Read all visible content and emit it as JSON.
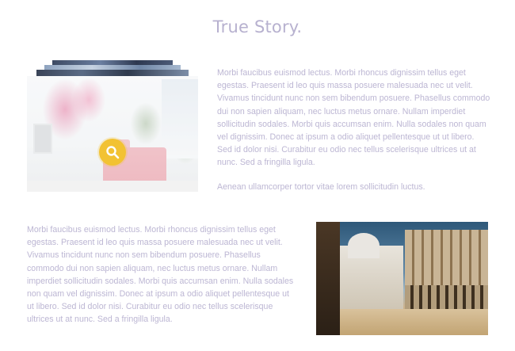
{
  "page": {
    "title": "True Story."
  },
  "gallery": {
    "search_icon": "search-icon",
    "accent_color": "#f2c233"
  },
  "sections": [
    {
      "paragraph": "Morbi faucibus euismod lectus. Morbi rhoncus dignissim tellus eget egestas. Praesent id leo quis massa posuere malesuada nec ut velit. Vivamus tincidunt nunc non sem bibendum posuere. Phasellus commodo dui non sapien aliquam, nec luctus metus ornare. Nullam imperdiet sollicitudin sodales. Morbi quis accumsan enim. Nulla sodales non quam vel dignissim. Donec at ipsum a odio aliquet pellentesque ut ut libero. Sed id dolor nisi. Curabitur eu odio nec tellus scelerisque ultrices ut at nunc. Sed a fringilla ligula.",
      "paragraph2": "Aenean ullamcorper tortor vitae lorem sollicitudin luctus."
    },
    {
      "paragraph": "Morbi faucibus euismod lectus. Morbi rhoncus dignissim tellus eget egestas. Praesent id leo quis massa posuere malesuada nec ut velit. Vivamus tincidunt nunc non sem bibendum posuere. Phasellus commodo dui non sapien aliquam, nec luctus metus ornare. Nullam imperdiet sollicitudin sodales. Morbi quis accumsan enim. Nulla sodales non quam vel dignissim. Donec at ipsum a odio aliquet pellentesque ut ut libero. Sed id dolor nisi. Curabitur eu odio nec tellus scelerisque ultrices ut at nunc. Sed a fringilla ligula."
    }
  ]
}
